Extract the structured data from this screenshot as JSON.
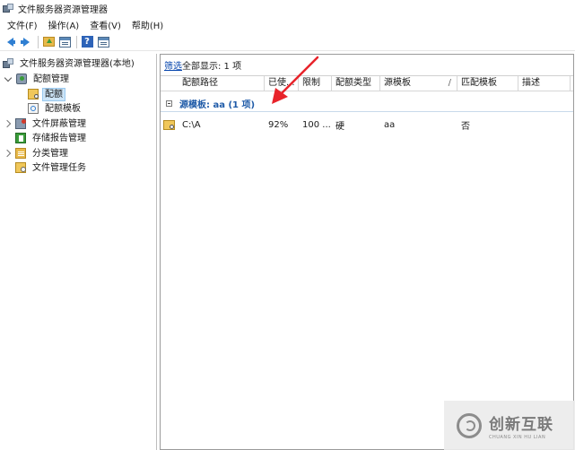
{
  "window": {
    "title": "文件服务器资源管理器"
  },
  "menu": [
    {
      "label": "文件(F)"
    },
    {
      "label": "操作(A)"
    },
    {
      "label": "查看(V)"
    },
    {
      "label": "帮助(H)"
    }
  ],
  "toolbar": {
    "icons": [
      "back-arrow-icon",
      "forward-arrow-icon",
      "folder-up-icon",
      "show-hide-tree-icon",
      "help-icon",
      "action-pane-icon"
    ],
    "help_glyph": "?"
  },
  "tree": {
    "root": "文件服务器资源管理器(本地)",
    "quota_management": "配额管理",
    "quota": "配额",
    "quota_templates": "配额模板",
    "file_screening": "文件屏蔽管理",
    "storage_reports": "存储报告管理",
    "classification": "分类管理",
    "file_management_tasks": "文件管理任务"
  },
  "list": {
    "filter_link": "筛选",
    "filter_text": "全部显示: 1 项",
    "columns": [
      "配额路径",
      "已使...",
      "限制",
      "配额类型",
      "源模板",
      "匹配模板",
      "描述"
    ],
    "sort_mark": "/",
    "group_label": "源模板: aa (1 项)",
    "rows": [
      {
        "path": "C:\\A",
        "used": "92%",
        "limit": "100 ...",
        "type": "硬",
        "source_template": "aa",
        "match_template": "否",
        "description": ""
      }
    ]
  },
  "annotation": {
    "color": "#e8232a"
  },
  "watermark": {
    "text": "创新互联",
    "subtext": "CHUANG XIN HU LIAN"
  }
}
